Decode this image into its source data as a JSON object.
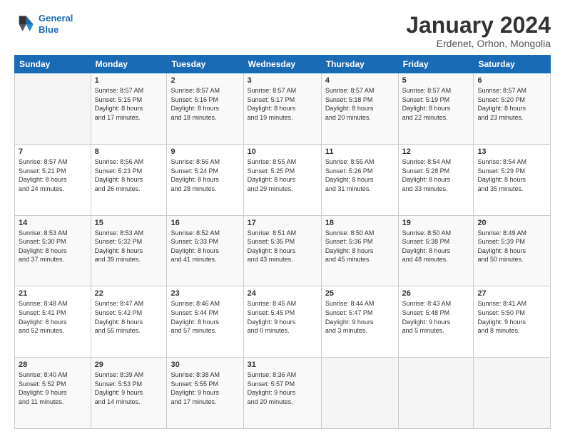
{
  "logo": {
    "line1": "General",
    "line2": "Blue"
  },
  "title": "January 2024",
  "subtitle": "Erdenet, Orhon, Mongolia",
  "headers": [
    "Sunday",
    "Monday",
    "Tuesday",
    "Wednesday",
    "Thursday",
    "Friday",
    "Saturday"
  ],
  "weeks": [
    [
      {
        "day": "",
        "info": ""
      },
      {
        "day": "1",
        "info": "Sunrise: 8:57 AM\nSunset: 5:15 PM\nDaylight: 8 hours\nand 17 minutes."
      },
      {
        "day": "2",
        "info": "Sunrise: 8:57 AM\nSunset: 5:16 PM\nDaylight: 8 hours\nand 18 minutes."
      },
      {
        "day": "3",
        "info": "Sunrise: 8:57 AM\nSunset: 5:17 PM\nDaylight: 8 hours\nand 19 minutes."
      },
      {
        "day": "4",
        "info": "Sunrise: 8:57 AM\nSunset: 5:18 PM\nDaylight: 8 hours\nand 20 minutes."
      },
      {
        "day": "5",
        "info": "Sunrise: 8:57 AM\nSunset: 5:19 PM\nDaylight: 8 hours\nand 22 minutes."
      },
      {
        "day": "6",
        "info": "Sunrise: 8:57 AM\nSunset: 5:20 PM\nDaylight: 8 hours\nand 23 minutes."
      }
    ],
    [
      {
        "day": "7",
        "info": "Sunrise: 8:57 AM\nSunset: 5:21 PM\nDaylight: 8 hours\nand 24 minutes."
      },
      {
        "day": "8",
        "info": "Sunrise: 8:56 AM\nSunset: 5:23 PM\nDaylight: 8 hours\nand 26 minutes."
      },
      {
        "day": "9",
        "info": "Sunrise: 8:56 AM\nSunset: 5:24 PM\nDaylight: 8 hours\nand 28 minutes."
      },
      {
        "day": "10",
        "info": "Sunrise: 8:55 AM\nSunset: 5:25 PM\nDaylight: 8 hours\nand 29 minutes."
      },
      {
        "day": "11",
        "info": "Sunrise: 8:55 AM\nSunset: 5:26 PM\nDaylight: 8 hours\nand 31 minutes."
      },
      {
        "day": "12",
        "info": "Sunrise: 8:54 AM\nSunset: 5:28 PM\nDaylight: 8 hours\nand 33 minutes."
      },
      {
        "day": "13",
        "info": "Sunrise: 8:54 AM\nSunset: 5:29 PM\nDaylight: 8 hours\nand 35 minutes."
      }
    ],
    [
      {
        "day": "14",
        "info": "Sunrise: 8:53 AM\nSunset: 5:30 PM\nDaylight: 8 hours\nand 37 minutes."
      },
      {
        "day": "15",
        "info": "Sunrise: 8:53 AM\nSunset: 5:32 PM\nDaylight: 8 hours\nand 39 minutes."
      },
      {
        "day": "16",
        "info": "Sunrise: 8:52 AM\nSunset: 5:33 PM\nDaylight: 8 hours\nand 41 minutes."
      },
      {
        "day": "17",
        "info": "Sunrise: 8:51 AM\nSunset: 5:35 PM\nDaylight: 8 hours\nand 43 minutes."
      },
      {
        "day": "18",
        "info": "Sunrise: 8:50 AM\nSunset: 5:36 PM\nDaylight: 8 hours\nand 45 minutes."
      },
      {
        "day": "19",
        "info": "Sunrise: 8:50 AM\nSunset: 5:38 PM\nDaylight: 8 hours\nand 48 minutes."
      },
      {
        "day": "20",
        "info": "Sunrise: 8:49 AM\nSunset: 5:39 PM\nDaylight: 8 hours\nand 50 minutes."
      }
    ],
    [
      {
        "day": "21",
        "info": "Sunrise: 8:48 AM\nSunset: 5:41 PM\nDaylight: 8 hours\nand 52 minutes."
      },
      {
        "day": "22",
        "info": "Sunrise: 8:47 AM\nSunset: 5:42 PM\nDaylight: 8 hours\nand 55 minutes."
      },
      {
        "day": "23",
        "info": "Sunrise: 8:46 AM\nSunset: 5:44 PM\nDaylight: 8 hours\nand 57 minutes."
      },
      {
        "day": "24",
        "info": "Sunrise: 8:45 AM\nSunset: 5:45 PM\nDaylight: 9 hours\nand 0 minutes."
      },
      {
        "day": "25",
        "info": "Sunrise: 8:44 AM\nSunset: 5:47 PM\nDaylight: 9 hours\nand 3 minutes."
      },
      {
        "day": "26",
        "info": "Sunrise: 8:43 AM\nSunset: 5:48 PM\nDaylight: 9 hours\nand 5 minutes."
      },
      {
        "day": "27",
        "info": "Sunrise: 8:41 AM\nSunset: 5:50 PM\nDaylight: 9 hours\nand 8 minutes."
      }
    ],
    [
      {
        "day": "28",
        "info": "Sunrise: 8:40 AM\nSunset: 5:52 PM\nDaylight: 9 hours\nand 11 minutes."
      },
      {
        "day": "29",
        "info": "Sunrise: 8:39 AM\nSunset: 5:53 PM\nDaylight: 9 hours\nand 14 minutes."
      },
      {
        "day": "30",
        "info": "Sunrise: 8:38 AM\nSunset: 5:55 PM\nDaylight: 9 hours\nand 17 minutes."
      },
      {
        "day": "31",
        "info": "Sunrise: 8:36 AM\nSunset: 5:57 PM\nDaylight: 9 hours\nand 20 minutes."
      },
      {
        "day": "",
        "info": ""
      },
      {
        "day": "",
        "info": ""
      },
      {
        "day": "",
        "info": ""
      }
    ]
  ]
}
